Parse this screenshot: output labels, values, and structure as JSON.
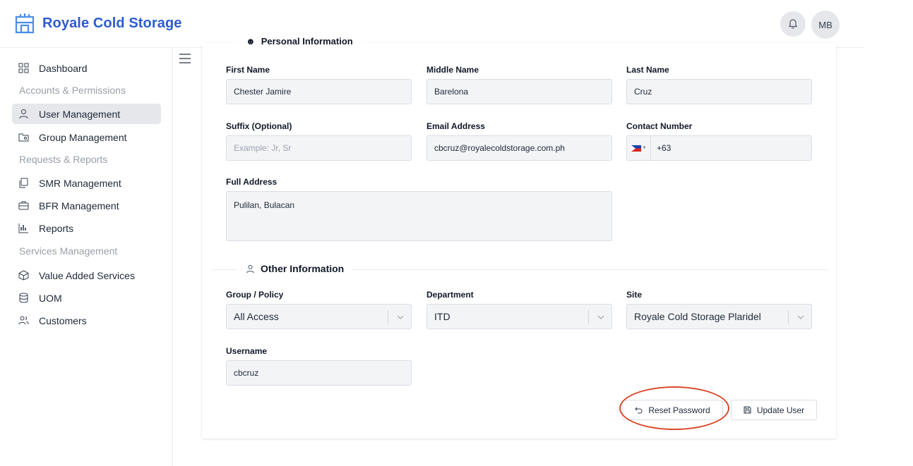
{
  "app": {
    "title": "Royale Cold Storage",
    "user_initials": "MB",
    "brand_color": "#2c5ccf"
  },
  "sidebar": {
    "dashboard": "Dashboard",
    "section_accounts": "Accounts & Permissions",
    "user_management": "User Management",
    "group_management": "Group Management",
    "section_requests": "Requests & Reports",
    "smr_management": "SMR Management",
    "bfr_management": "BFR Management",
    "reports": "Reports",
    "section_services": "Services Management",
    "value_added_services": "Value Added Services",
    "uom": "UOM",
    "customers": "Customers"
  },
  "form": {
    "personal_section": "Personal Information",
    "first_name_label": "First Name",
    "first_name_value": "Chester Jamire",
    "middle_name_label": "Middle Name",
    "middle_name_value": "Barelona",
    "last_name_label": "Last Name",
    "last_name_value": "Cruz",
    "suffix_label": "Suffix (Optional)",
    "suffix_placeholder": "Example: Jr, Sr",
    "email_label": "Email Address",
    "email_value": "cbcruz@royalecoldstorage.com.ph",
    "contact_label": "Contact Number",
    "contact_value": "+63",
    "address_label": "Full Address",
    "address_value": "Pulilan, Bulacan",
    "other_section": "Other Information",
    "group_label": "Group / Policy",
    "group_value": "All Access",
    "department_label": "Department",
    "department_value": "ITD",
    "site_label": "Site",
    "site_value": "Royale Cold Storage Plaridel",
    "username_label": "Username",
    "username_value": "cbcruz"
  },
  "actions": {
    "reset_password": "Reset Password",
    "update_user": "Update User"
  },
  "annotation_color": "#d9472b"
}
